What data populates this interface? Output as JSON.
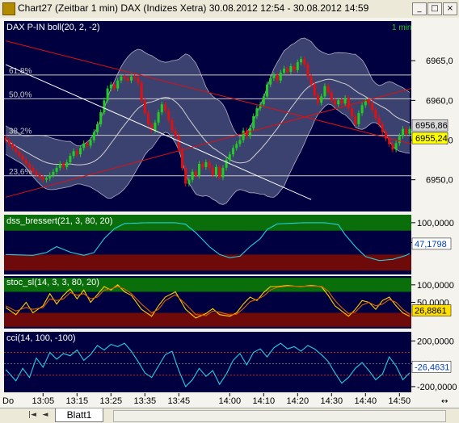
{
  "window": {
    "title": "Chart27 (Zeitbar 1 min)  DAX (Indizes Xetra) 30.08.2012 12:54 - 30.08.2012 14:59",
    "buttons": [
      "_",
      "□",
      "×"
    ]
  },
  "tabs": {
    "sheet_label": "Blatt1",
    "nav_first": "|◄",
    "nav_prev": "◄"
  },
  "colors": {
    "background": "#000040",
    "candle_up": "#22CC22",
    "candle_down": "#E01010",
    "zone_green": "#0A6E0A",
    "zone_red": "#6E0A0A",
    "fib_line": "#C8C8C8",
    "white_trend": "#FFFFFF",
    "red_trend": "#E01010",
    "dss": "#22D0E0",
    "stoc_k": "#FFD000",
    "stoc_d": "#D86000",
    "cci": "#22D0E0"
  },
  "chart_data": [
    {
      "type": "candlestick",
      "name": "price",
      "title": "DAX P-IN",
      "indicator": "boll(20, 2, -2)",
      "timeframe": "1 min",
      "ylim": [
        6946,
        6970
      ],
      "y_ticks": [
        6950,
        6955,
        6960,
        6965
      ],
      "y_tick_labels": [
        "6950,0",
        "6955,0",
        "6960,0",
        "6965,0"
      ],
      "price_badges": [
        {
          "label": "6956,86",
          "value": 6956.86
        },
        {
          "label": "6955,24",
          "value": 6955.24
        }
      ],
      "fib_levels": [
        {
          "label": "61,8%",
          "value": 6963.2
        },
        {
          "label": "50,0%",
          "value": 6960.2
        },
        {
          "label": "38,2%",
          "value": 6955.6
        },
        {
          "label": "23,6%",
          "value": 6950.5
        }
      ],
      "x_tick_labels": [
        "Do",
        "13:05",
        "13:15",
        "13:25",
        "13:35",
        "13:45",
        "14:00",
        "14:10",
        "14:20",
        "14:30",
        "14:40",
        "14:50"
      ],
      "x_tick_index": [
        0,
        11,
        21,
        31,
        41,
        51,
        66,
        76,
        86,
        96,
        106,
        116
      ],
      "close": [
        6955,
        6954.5,
        6954,
        6953.5,
        6953,
        6952.5,
        6952,
        6951.5,
        6951,
        6950.6,
        6950.3,
        6950,
        6950.2,
        6950.6,
        6951,
        6951.5,
        6952,
        6951.6,
        6952.2,
        6953,
        6953.6,
        6953.2,
        6954,
        6954.6,
        6954.3,
        6955,
        6956,
        6957,
        6958.5,
        6960,
        6961.5,
        6962,
        6961.5,
        6962.5,
        6963,
        6962.8,
        6962.5,
        6963,
        6962.8,
        6962.2,
        6960,
        6958.4,
        6957,
        6956.2,
        6957.2,
        6958.5,
        6959.5,
        6958.7,
        6957.5,
        6956.2,
        6955.5,
        6953.8,
        6951.5,
        6949.5,
        6950,
        6951,
        6950.5,
        6952,
        6951.6,
        6952.2,
        6951.5,
        6950.6,
        6951.6,
        6950.3,
        6951.5,
        6952.5,
        6953.2,
        6954,
        6954.5,
        6955,
        6956.2,
        6955.5,
        6956.5,
        6958,
        6959,
        6959.5,
        6960.5,
        6962,
        6962.8,
        6963.2,
        6962.5,
        6963.5,
        6964,
        6963.6,
        6964.3,
        6963.8,
        6964.8,
        6965.2,
        6964.5,
        6963,
        6962,
        6960.6,
        6959.7,
        6960.5,
        6961.8,
        6961,
        6960,
        6959.5,
        6960,
        6959.6,
        6960.3,
        6959,
        6958,
        6957,
        6958.4,
        6959.4,
        6960,
        6959.6,
        6958.8,
        6957.8,
        6957,
        6956,
        6955.2,
        6954.5,
        6953.8,
        6954.6,
        6955.5,
        6956.4,
        6955.8,
        6956.4
      ]
    },
    {
      "type": "line",
      "name": "dss",
      "title": "dss_bressert(21, 3, 80, 20)",
      "ylim": [
        -30,
        120
      ],
      "y_ticks": [
        100,
        50
      ],
      "y_tick_labels": [
        "100,0000",
        "50,0000"
      ],
      "zones": {
        "upper": 80,
        "lower": 20
      },
      "last_value_label": "47,1798",
      "last_value": 47.1798,
      "keypoints": [
        [
          0,
          20
        ],
        [
          8,
          18
        ],
        [
          12,
          25
        ],
        [
          15,
          40
        ],
        [
          19,
          26
        ],
        [
          23,
          18
        ],
        [
          26,
          25
        ],
        [
          29,
          60
        ],
        [
          32,
          85
        ],
        [
          35,
          98
        ],
        [
          42,
          100
        ],
        [
          50,
          100
        ],
        [
          53,
          96
        ],
        [
          56,
          75
        ],
        [
          60,
          40
        ],
        [
          63,
          20
        ],
        [
          66,
          12
        ],
        [
          69,
          16
        ],
        [
          72,
          40
        ],
        [
          75,
          60
        ],
        [
          77,
          83
        ],
        [
          80,
          97
        ],
        [
          88,
          100
        ],
        [
          94,
          100
        ],
        [
          98,
          95
        ],
        [
          100,
          70
        ],
        [
          103,
          40
        ],
        [
          106,
          15
        ],
        [
          110,
          5
        ],
        [
          114,
          8
        ],
        [
          118,
          18
        ],
        [
          121,
          32
        ],
        [
          123,
          47
        ]
      ]
    },
    {
      "type": "line",
      "name": "stoc",
      "title": "stoc_sl(14, 3, 3, 80, 20)",
      "ylim": [
        -25,
        125
      ],
      "y_ticks": [
        100,
        50
      ],
      "y_tick_labels": [
        "100,0000",
        "50,0000"
      ],
      "zones": {
        "upper": 80,
        "lower": 20
      },
      "last_value_label": "26,8861",
      "last_value": 26.8861,
      "keypoints_k": [
        [
          0,
          35
        ],
        [
          3,
          15
        ],
        [
          6,
          50
        ],
        [
          8,
          20
        ],
        [
          11,
          40
        ],
        [
          13,
          75
        ],
        [
          15,
          45
        ],
        [
          17,
          70
        ],
        [
          19,
          88
        ],
        [
          21,
          60
        ],
        [
          23,
          85
        ],
        [
          25,
          50
        ],
        [
          27,
          72
        ],
        [
          29,
          95
        ],
        [
          31,
          85
        ],
        [
          33,
          100
        ],
        [
          35,
          80
        ],
        [
          37,
          70
        ],
        [
          40,
          30
        ],
        [
          43,
          10
        ],
        [
          45,
          40
        ],
        [
          47,
          65
        ],
        [
          50,
          80
        ],
        [
          53,
          30
        ],
        [
          56,
          5
        ],
        [
          59,
          18
        ],
        [
          61,
          32
        ],
        [
          63,
          15
        ],
        [
          66,
          10
        ],
        [
          68,
          20
        ],
        [
          70,
          45
        ],
        [
          72,
          65
        ],
        [
          74,
          55
        ],
        [
          76,
          78
        ],
        [
          78,
          95
        ],
        [
          80,
          95
        ],
        [
          83,
          98
        ],
        [
          87,
          95
        ],
        [
          90,
          98
        ],
        [
          93,
          95
        ],
        [
          95,
          70
        ],
        [
          97,
          40
        ],
        [
          99,
          25
        ],
        [
          101,
          10
        ],
        [
          103,
          30
        ],
        [
          105,
          55
        ],
        [
          107,
          50
        ],
        [
          109,
          30
        ],
        [
          111,
          55
        ],
        [
          113,
          65
        ],
        [
          115,
          40
        ],
        [
          117,
          20
        ],
        [
          119,
          10
        ],
        [
          121,
          18
        ],
        [
          123,
          27
        ]
      ],
      "keypoints_d": [
        [
          0,
          40
        ],
        [
          3,
          25
        ],
        [
          6,
          35
        ],
        [
          8,
          30
        ],
        [
          11,
          35
        ],
        [
          13,
          60
        ],
        [
          15,
          55
        ],
        [
          17,
          60
        ],
        [
          19,
          78
        ],
        [
          21,
          70
        ],
        [
          23,
          75
        ],
        [
          25,
          60
        ],
        [
          27,
          65
        ],
        [
          29,
          85
        ],
        [
          31,
          88
        ],
        [
          33,
          95
        ],
        [
          35,
          88
        ],
        [
          37,
          75
        ],
        [
          40,
          45
        ],
        [
          43,
          20
        ],
        [
          45,
          30
        ],
        [
          47,
          55
        ],
        [
          50,
          72
        ],
        [
          53,
          45
        ],
        [
          56,
          15
        ],
        [
          59,
          12
        ],
        [
          61,
          25
        ],
        [
          63,
          22
        ],
        [
          66,
          14
        ],
        [
          68,
          16
        ],
        [
          70,
          32
        ],
        [
          72,
          52
        ],
        [
          74,
          58
        ],
        [
          76,
          68
        ],
        [
          78,
          85
        ],
        [
          80,
          93
        ],
        [
          83,
          96
        ],
        [
          87,
          96
        ],
        [
          90,
          96
        ],
        [
          93,
          96
        ],
        [
          95,
          82
        ],
        [
          97,
          55
        ],
        [
          99,
          35
        ],
        [
          101,
          18
        ],
        [
          103,
          22
        ],
        [
          105,
          42
        ],
        [
          107,
          50
        ],
        [
          109,
          40
        ],
        [
          111,
          45
        ],
        [
          113,
          58
        ],
        [
          115,
          50
        ],
        [
          117,
          30
        ],
        [
          119,
          16
        ],
        [
          121,
          15
        ],
        [
          123,
          22
        ]
      ]
    },
    {
      "type": "line",
      "name": "cci",
      "title": "cci(14, 100, -100)",
      "ylim": [
        -250,
        280
      ],
      "y_ticks": [
        200,
        0,
        -200
      ],
      "y_tick_labels": [
        "200,0000",
        "0,0000",
        "-200,0000"
      ],
      "zones": {
        "upper": 100,
        "lower": -100
      },
      "last_value_label": "-26,4631",
      "last_value": -26.4631,
      "keypoints": [
        [
          0,
          -50
        ],
        [
          3,
          -150
        ],
        [
          5,
          -40
        ],
        [
          7,
          -120
        ],
        [
          9,
          50
        ],
        [
          11,
          -30
        ],
        [
          13,
          100
        ],
        [
          15,
          40
        ],
        [
          17,
          90
        ],
        [
          19,
          70
        ],
        [
          21,
          120
        ],
        [
          23,
          30
        ],
        [
          25,
          80
        ],
        [
          27,
          160
        ],
        [
          29,
          120
        ],
        [
          31,
          170
        ],
        [
          33,
          150
        ],
        [
          35,
          180
        ],
        [
          37,
          110
        ],
        [
          39,
          20
        ],
        [
          41,
          -80
        ],
        [
          43,
          -120
        ],
        [
          45,
          -20
        ],
        [
          47,
          80
        ],
        [
          49,
          110
        ],
        [
          51,
          -60
        ],
        [
          53,
          -200
        ],
        [
          55,
          -140
        ],
        [
          57,
          -40
        ],
        [
          59,
          -110
        ],
        [
          61,
          -60
        ],
        [
          63,
          -180
        ],
        [
          65,
          -90
        ],
        [
          67,
          30
        ],
        [
          69,
          90
        ],
        [
          71,
          -10
        ],
        [
          73,
          100
        ],
        [
          75,
          130
        ],
        [
          77,
          60
        ],
        [
          79,
          140
        ],
        [
          81,
          180
        ],
        [
          83,
          130
        ],
        [
          85,
          150
        ],
        [
          87,
          110
        ],
        [
          89,
          160
        ],
        [
          91,
          130
        ],
        [
          93,
          80
        ],
        [
          95,
          20
        ],
        [
          97,
          -80
        ],
        [
          99,
          -170
        ],
        [
          101,
          -120
        ],
        [
          103,
          -40
        ],
        [
          105,
          10
        ],
        [
          107,
          -60
        ],
        [
          109,
          -140
        ],
        [
          111,
          -90
        ],
        [
          113,
          60
        ],
        [
          115,
          -20
        ],
        [
          117,
          -140
        ],
        [
          119,
          -80
        ],
        [
          121,
          -40
        ],
        [
          123,
          -26
        ]
      ]
    }
  ]
}
